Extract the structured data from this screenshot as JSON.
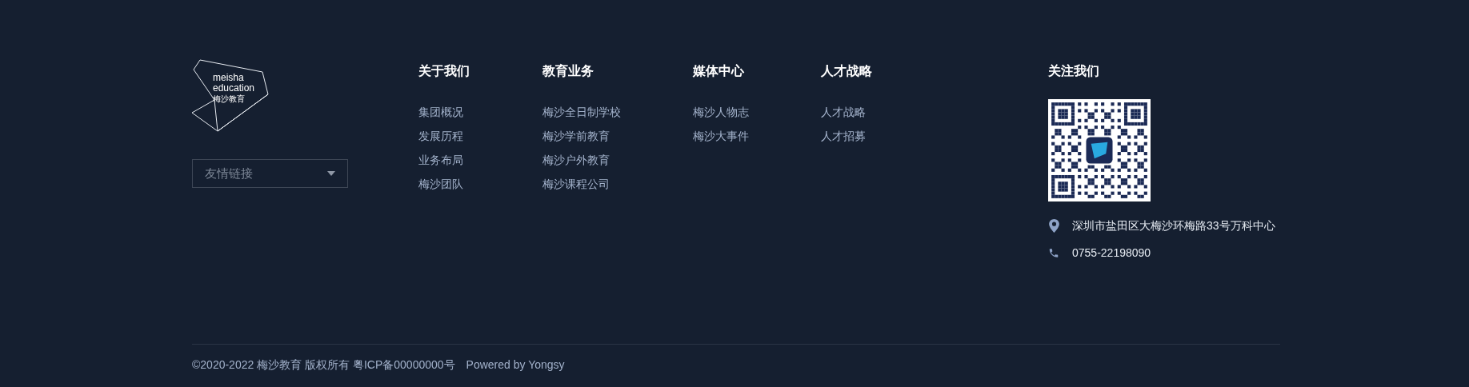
{
  "logo": {
    "lines": [
      "meisha",
      "education",
      "梅沙教育"
    ]
  },
  "friend_links": {
    "placeholder": "友情链接"
  },
  "columns": [
    {
      "heading": "关于我们",
      "items": [
        "集团概况",
        "发展历程",
        "业务布局",
        "梅沙团队"
      ]
    },
    {
      "heading": "教育业务",
      "items": [
        "梅沙全日制学校",
        "梅沙学前教育",
        "梅沙户外教育",
        "梅沙课程公司"
      ]
    },
    {
      "heading": "媒体中心",
      "items": [
        "梅沙人物志",
        "梅沙大事件"
      ]
    },
    {
      "heading": "人才战略",
      "items": [
        "人才战略",
        "人才招募"
      ]
    }
  ],
  "follow": {
    "heading": "关注我们",
    "contacts": [
      {
        "kind": "address",
        "text": "深圳市盐田区大梅沙环梅路33号万科中心"
      },
      {
        "kind": "phone",
        "text": "0755-22198090"
      }
    ]
  },
  "copyright": "©2020-2022 梅沙教育 版权所有 粤ICP备00000000号",
  "powered_by": "Powered by Yongsy"
}
